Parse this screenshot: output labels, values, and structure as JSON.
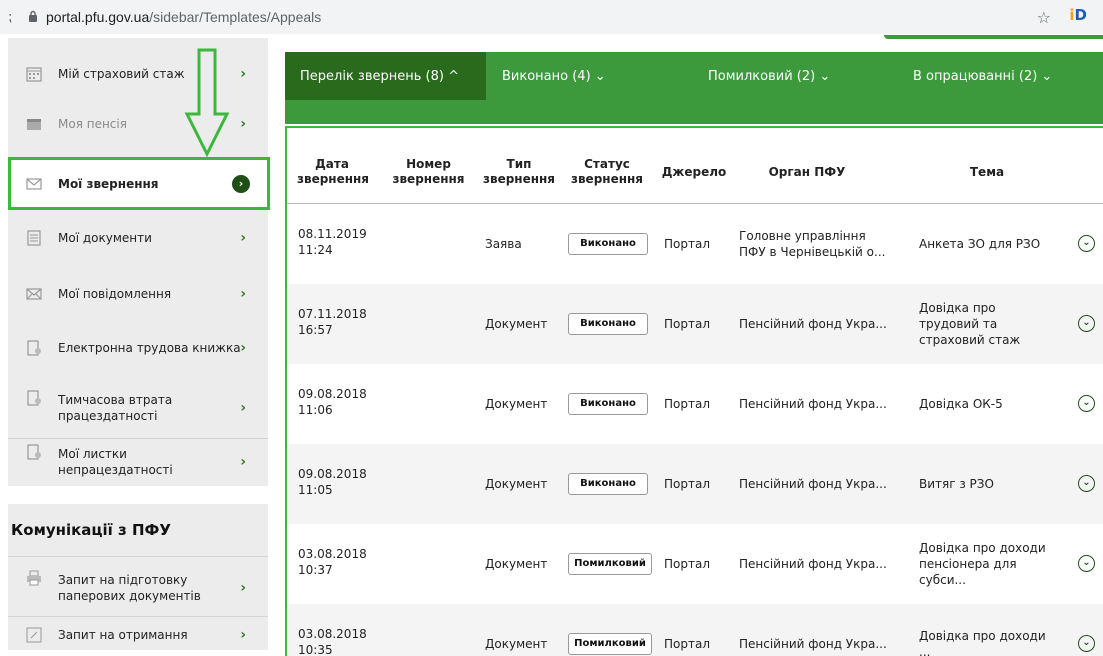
{
  "browser": {
    "host": "portal.pfu.gov.ua",
    "path": "/sidebar/Templates/Appeals",
    "star_icon": "☆",
    "ext_icon": "⁏",
    "profile_icon": "iD"
  },
  "sidebar": {
    "items": [
      {
        "label": "Мій страховий стаж",
        "icon": "calendar-icon"
      },
      {
        "label": "Моя пенсія",
        "icon": "wallet-icon"
      },
      {
        "label": "Мої звернення",
        "icon": "envelope-icon"
      },
      {
        "label": "Мої документи",
        "icon": "document-icon"
      },
      {
        "label": "Мої повідомлення",
        "icon": "envelope-icon"
      },
      {
        "label": "Електронна трудова книжка",
        "icon": "book-icon"
      },
      {
        "label": "Тимчасова втрата працездатності",
        "icon": "book-icon"
      },
      {
        "label": "Мої листки непрацездатності",
        "icon": "book-icon"
      }
    ],
    "comm_title": "Комунікації з ПФУ",
    "comm_items": [
      {
        "label": "Запит на підготовку паперових документів",
        "icon": "printer-icon"
      },
      {
        "label": "Запит на отримання",
        "icon": "edit-icon"
      }
    ]
  },
  "tabs": [
    {
      "label": "Перелік звернень (8) ^"
    },
    {
      "label": "Виконано (4) ⌄"
    },
    {
      "label": "Помилковий (2) ⌄"
    },
    {
      "label": "В опрацюванні (2) ⌄"
    }
  ],
  "table": {
    "headers": [
      "Дата звернення",
      "Номер звернення",
      "Тип звернення",
      "Статус звернення",
      "Джерело",
      "Орган ПФУ",
      "Тема"
    ],
    "rows": [
      {
        "date": "08.11.2019",
        "time": "11:24",
        "number": "",
        "type": "Заява",
        "status": "Виконано",
        "source": "Портал",
        "organ": "Головне управління ПФУ в Чернівецькій о...",
        "topic": "Анкета ЗО для РЗО"
      },
      {
        "date": "07.11.2018",
        "time": "16:57",
        "number": "",
        "type": "Документ",
        "status": "Виконано",
        "source": "Портал",
        "organ": "Пенсійний фонд Укра...",
        "topic": "Довідка про трудовий та страховий стаж"
      },
      {
        "date": "09.08.2018",
        "time": "11:06",
        "number": "",
        "type": "Документ",
        "status": "Виконано",
        "source": "Портал",
        "organ": "Пенсійний фонд Укра...",
        "topic": "Довідка ОК-5"
      },
      {
        "date": "09.08.2018",
        "time": "11:05",
        "number": "",
        "type": "Документ",
        "status": "Виконано",
        "source": "Портал",
        "organ": "Пенсійний фонд Укра...",
        "topic": "Витяг з РЗО"
      },
      {
        "date": "03.08.2018",
        "time": "10:37",
        "number": "",
        "type": "Документ",
        "status": "Помилковий",
        "source": "Портал",
        "organ": "Пенсійний фонд Укра...",
        "topic": "Довідка про доходи пенсіонера для субси..."
      },
      {
        "date": "03.08.2018",
        "time": "10:35",
        "number": "",
        "type": "Документ",
        "status": "Помилковий",
        "source": "Портал",
        "organ": "Пенсійний фонд Укра...",
        "topic": "Довідка про доходи ..."
      }
    ]
  },
  "colors": {
    "accent": "#3c9a3c",
    "accent_dark": "#2a6a1c",
    "highlight": "#3cb83c"
  }
}
